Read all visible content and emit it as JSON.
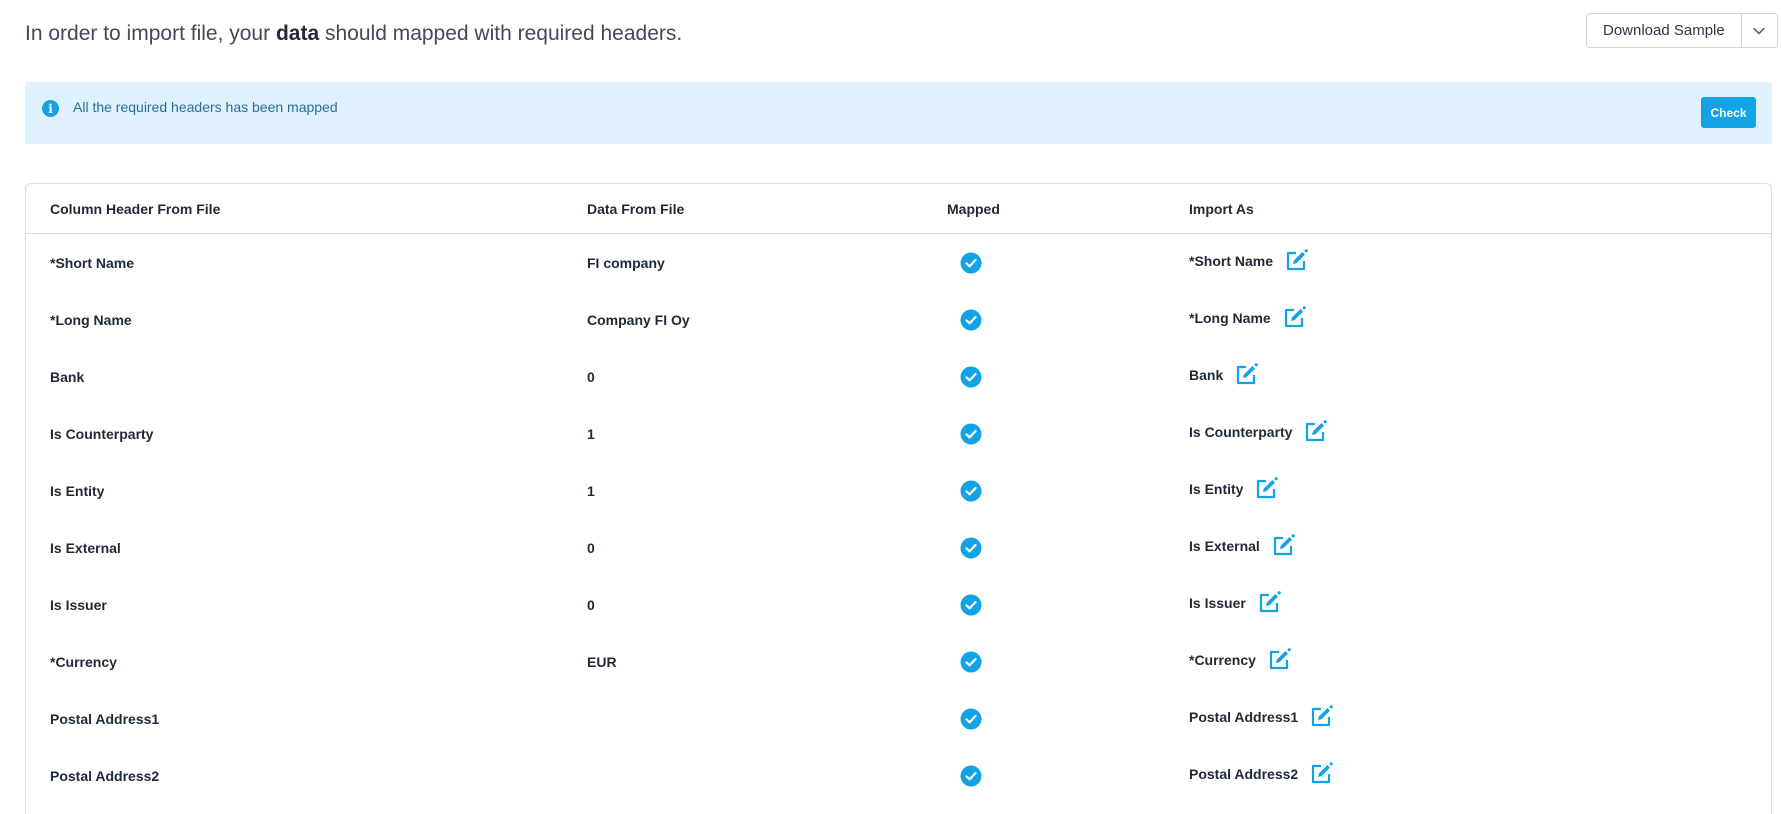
{
  "intro": {
    "before": "In order to import file, your",
    "strong": "data",
    "after": "should mapped with required headers."
  },
  "download": {
    "label": "Download Sample",
    "caret_icon": "chevron-down-icon"
  },
  "alert": {
    "icon": "info-icon",
    "message": "All the required headers has been mapped",
    "check_label": "Check"
  },
  "table": {
    "headers": {
      "column_header": "Column Header From File",
      "data_from_file": "Data From File",
      "mapped": "Mapped",
      "import_as": "Import As"
    },
    "rows": [
      {
        "column": "*Short Name",
        "data": "FI company",
        "mapped": true,
        "import_as": "*Short Name"
      },
      {
        "column": "*Long Name",
        "data": "Company FI Oy",
        "mapped": true,
        "import_as": "*Long Name"
      },
      {
        "column": "Bank",
        "data": "0",
        "mapped": true,
        "import_as": "Bank"
      },
      {
        "column": "Is Counterparty",
        "data": "1",
        "mapped": true,
        "import_as": "Is Counterparty"
      },
      {
        "column": "Is Entity",
        "data": "1",
        "mapped": true,
        "import_as": "Is Entity"
      },
      {
        "column": "Is External",
        "data": "0",
        "mapped": true,
        "import_as": "Is External"
      },
      {
        "column": "Is Issuer",
        "data": "0",
        "mapped": true,
        "import_as": "Is Issuer"
      },
      {
        "column": "*Currency",
        "data": "EUR",
        "mapped": true,
        "import_as": "*Currency"
      },
      {
        "column": "Postal Address1",
        "data": "",
        "mapped": true,
        "import_as": "Postal Address1"
      },
      {
        "column": "Postal Address2",
        "data": "",
        "mapped": true,
        "import_as": "Postal Address2"
      }
    ]
  },
  "colors": {
    "accent": "#11a3e6",
    "alert_bg": "#dff1fc",
    "alert_text": "#2b6f93"
  }
}
